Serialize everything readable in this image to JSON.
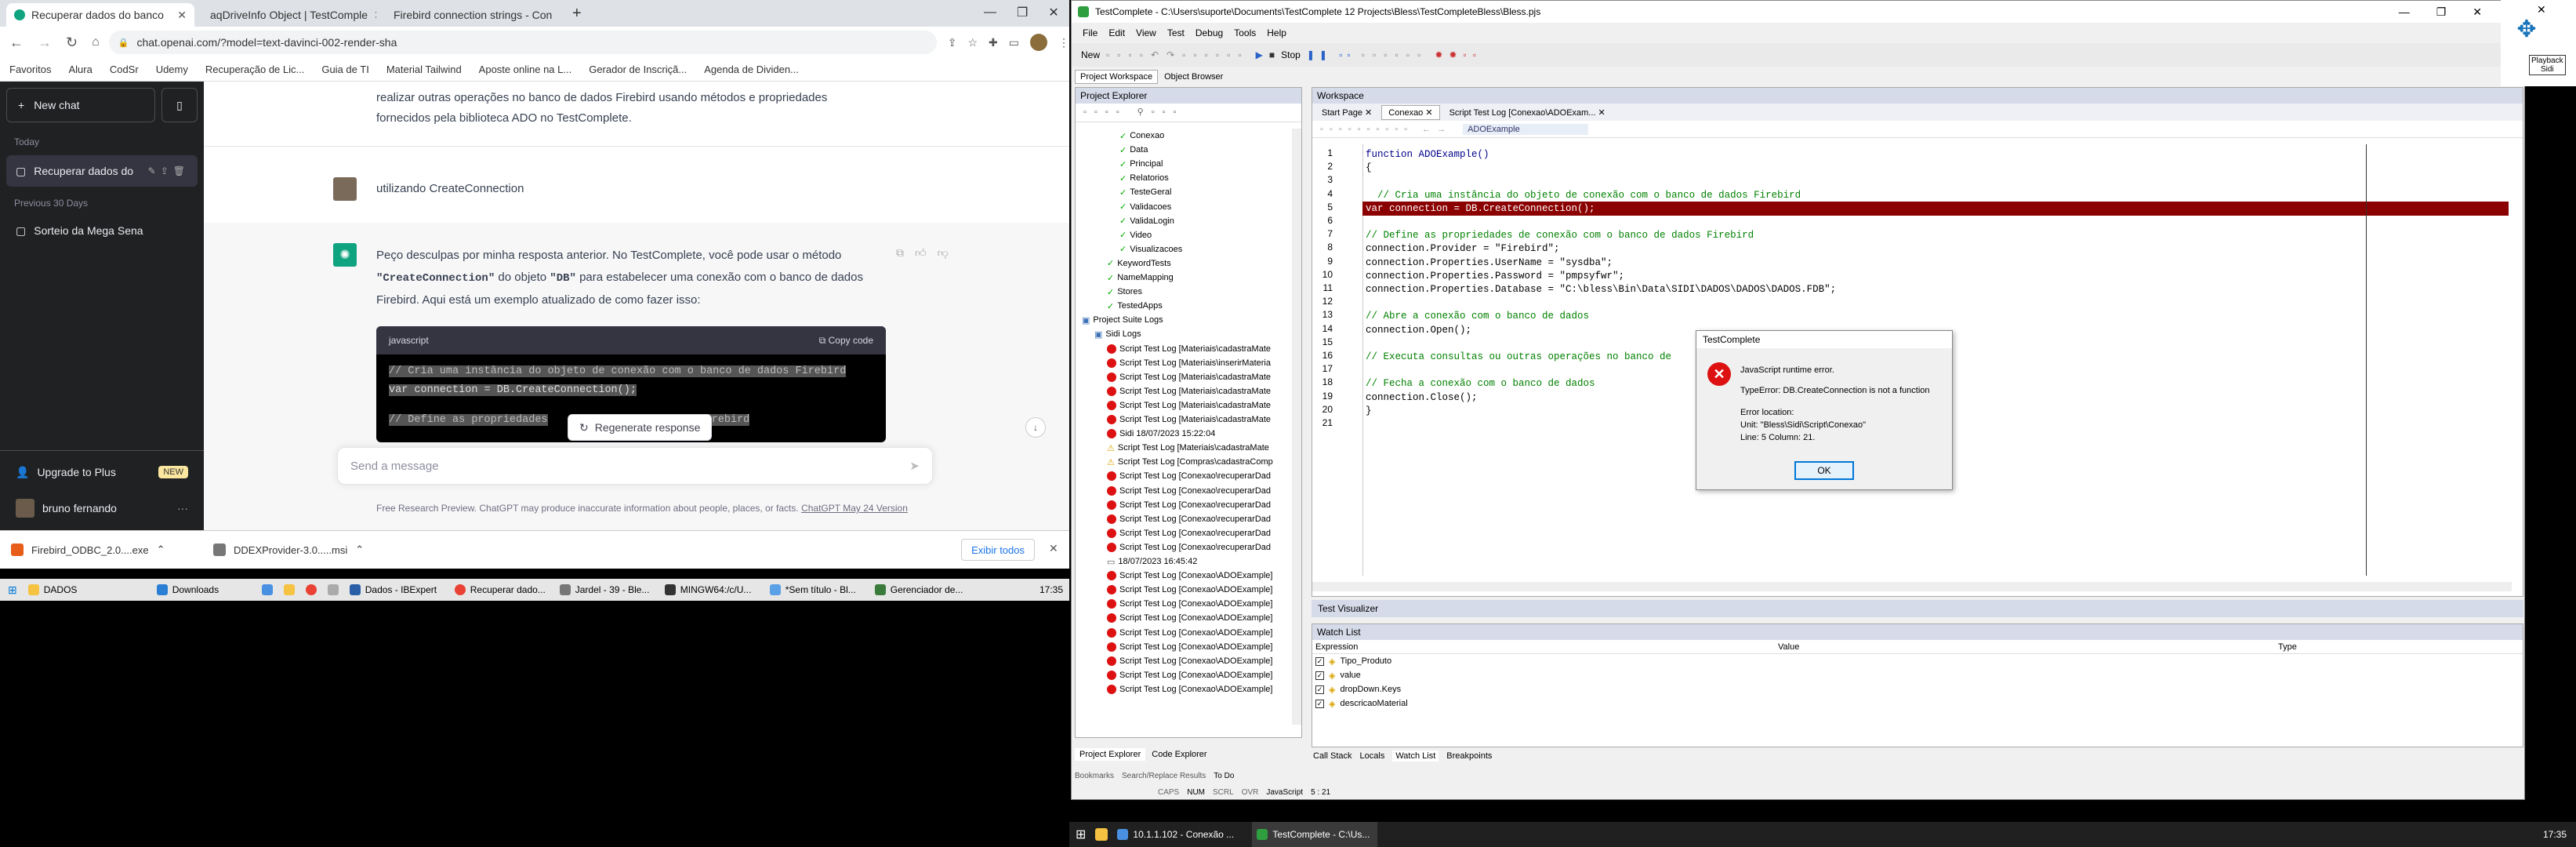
{
  "browser": {
    "tabs": [
      {
        "title": "Recuperar dados do banco",
        "active": true
      },
      {
        "title": "aqDriveInfo Object | TestComple",
        "active": false
      },
      {
        "title": "Firebird connection strings - Con",
        "active": false
      }
    ],
    "new_tab": "+",
    "url": "chat.openai.com/?model=text-davinci-002-render-sha",
    "bookmarks": [
      "Favoritos",
      "Alura",
      "CodSr",
      "Udemy",
      "Recuperação de Lic...",
      "Guia de TI",
      "Material Tailwind",
      "Aposte online na L...",
      "Gerador de Inscriçã...",
      "Agenda de Dividen..."
    ]
  },
  "sidebar": {
    "new_chat": "New chat",
    "today_label": "Today",
    "today_item": "Recuperar dados do",
    "prev_label": "Previous 30 Days",
    "prev_item": "Sorteio da Mega Sena",
    "upgrade": "Upgrade to Plus",
    "upgrade_badge": "NEW",
    "user": "bruno fernando"
  },
  "chat": {
    "top_text_1": "realizar outras operações no banco de dados Firebird usando métodos e propriedades",
    "top_text_2": "fornecidos pela biblioteca ADO no TestComplete.",
    "user_msg": "utilizando CreateConnection",
    "reply_1": "Peço desculpas por minha resposta anterior. No TestComplete, você pode usar o método",
    "reply_2a": "\"CreateConnection\"",
    "reply_2b": " do objeto ",
    "reply_2c": "\"DB\"",
    "reply_2d": " para estabelecer uma conexão com o banco de dados",
    "reply_3": "Firebird. Aqui está um exemplo atualizado de como fazer isso:",
    "code_lang": "javascript",
    "copy_code": "Copy code",
    "code_line_1": "// Cria uma instância do objeto de conexão com o banco de dados Firebird",
    "code_line_2": "var connection = DB.CreateConnection();",
    "code_line_3": "// Define as propriedades",
    "code_line_3b": "de dados Firebird",
    "regenerate": "Regenerate response",
    "placeholder": "Send a message",
    "disclaimer": "Free Research Preview. ChatGPT may produce inaccurate information about people, places, or facts.",
    "disclaimer_link": "ChatGPT May 24 Version"
  },
  "downloads": {
    "items": [
      "Firebird_ODBC_2.0....exe",
      "DDEXProvider-3.0.....msi"
    ],
    "show_all": "Exibir todos"
  },
  "taskbar1": {
    "items": [
      "DADOS",
      "Downloads",
      "Dados - IBExpert",
      "Recuperar dado...",
      "Jardel - 39 - Ble...",
      "MINGW64:/c/U...",
      "*Sem título - Bl...",
      "Gerenciador de..."
    ],
    "time": "17:35"
  },
  "taskbar2": {
    "items": [
      "10.1.1.102 - Conexão ...",
      "TestComplete - C:\\Us..."
    ],
    "time": "17:35"
  },
  "tc": {
    "title": "TestComplete - C:\\Users\\suporte\\Documents\\TestComplete 12 Projects\\Bless\\TestCompleteBless\\Bless.pjs",
    "menu": [
      "File",
      "Edit",
      "View",
      "Test",
      "Debug",
      "Tools",
      "Help"
    ],
    "toolbar_new": "New",
    "toolbar_stop": "Stop",
    "left_tabs": [
      "Project Workspace",
      "Object Browser"
    ],
    "explorer_title": "Project Explorer",
    "tree": [
      {
        "label": "Conexao",
        "indent": 3,
        "kind": "check"
      },
      {
        "label": "Data",
        "indent": 3,
        "kind": "check"
      },
      {
        "label": "Principal",
        "indent": 3,
        "kind": "check"
      },
      {
        "label": "Relatorios",
        "indent": 3,
        "kind": "check"
      },
      {
        "label": "TesteGeral",
        "indent": 3,
        "kind": "check"
      },
      {
        "label": "Validacoes",
        "indent": 3,
        "kind": "check"
      },
      {
        "label": "ValidaLogin",
        "indent": 3,
        "kind": "check"
      },
      {
        "label": "Video",
        "indent": 3,
        "kind": "check"
      },
      {
        "label": "Visualizacoes",
        "indent": 3,
        "kind": "check"
      },
      {
        "label": "KeywordTests",
        "indent": 2,
        "kind": "check"
      },
      {
        "label": "NameMapping",
        "indent": 2,
        "kind": "check"
      },
      {
        "label": "Stores",
        "indent": 2,
        "kind": "check"
      },
      {
        "label": "TestedApps",
        "indent": 2,
        "kind": "check"
      },
      {
        "label": "Project Suite Logs",
        "indent": 0,
        "kind": "folder"
      },
      {
        "label": "Sidi Logs",
        "indent": 1,
        "kind": "folder"
      },
      {
        "label": "Script Test Log [Materiais\\cadastraMate",
        "indent": 2,
        "kind": "err"
      },
      {
        "label": "Script Test Log [Materiais\\inserirMateria",
        "indent": 2,
        "kind": "err"
      },
      {
        "label": "Script Test Log [Materiais\\cadastraMate",
        "indent": 2,
        "kind": "err"
      },
      {
        "label": "Script Test Log [Materiais\\cadastraMate",
        "indent": 2,
        "kind": "err"
      },
      {
        "label": "Script Test Log [Materiais\\cadastraMate",
        "indent": 2,
        "kind": "err"
      },
      {
        "label": "Script Test Log [Materiais\\cadastraMate",
        "indent": 2,
        "kind": "err"
      },
      {
        "label": "Sidi 18/07/2023 15:22:04",
        "indent": 2,
        "kind": "err"
      },
      {
        "label": "Script Test Log [Materiais\\cadastraMate",
        "indent": 2,
        "kind": "warn"
      },
      {
        "label": "Script Test Log [Compras\\cadastraComp",
        "indent": 2,
        "kind": "warn"
      },
      {
        "label": "Script Test Log [Conexao\\recuperarDad",
        "indent": 2,
        "kind": "err"
      },
      {
        "label": "Script Test Log [Conexao\\recuperarDad",
        "indent": 2,
        "kind": "err"
      },
      {
        "label": "Script Test Log [Conexao\\recuperarDad",
        "indent": 2,
        "kind": "err"
      },
      {
        "label": "Script Test Log [Conexao\\recuperarDad",
        "indent": 2,
        "kind": "err"
      },
      {
        "label": "Script Test Log [Conexao\\recuperarDad",
        "indent": 2,
        "kind": "err"
      },
      {
        "label": "Script Test Log [Conexao\\recuperarDad",
        "indent": 2,
        "kind": "err"
      },
      {
        "label": "18/07/2023 16:45:42",
        "indent": 2,
        "kind": "doc"
      },
      {
        "label": "Script Test Log [Conexao\\ADOExample]",
        "indent": 2,
        "kind": "err"
      },
      {
        "label": "Script Test Log [Conexao\\ADOExample]",
        "indent": 2,
        "kind": "err"
      },
      {
        "label": "Script Test Log [Conexao\\ADOExample]",
        "indent": 2,
        "kind": "err"
      },
      {
        "label": "Script Test Log [Conexao\\ADOExample]",
        "indent": 2,
        "kind": "err"
      },
      {
        "label": "Script Test Log [Conexao\\ADOExample]",
        "indent": 2,
        "kind": "err"
      },
      {
        "label": "Script Test Log [Conexao\\ADOExample]",
        "indent": 2,
        "kind": "err"
      },
      {
        "label": "Script Test Log [Conexao\\ADOExample]",
        "indent": 2,
        "kind": "err"
      },
      {
        "label": "Script Test Log [Conexao\\ADOExample]",
        "indent": 2,
        "kind": "err"
      },
      {
        "label": "Script Test Log [Conexao\\ADOExample]",
        "indent": 2,
        "kind": "err"
      }
    ],
    "bottom_left_tabs": [
      "Project Explorer",
      "Code Explorer"
    ],
    "bottom_tabs2": [
      "Bookmarks",
      "Search/Replace Results",
      "To Do"
    ],
    "workspace_title": "Workspace",
    "doc_tabs": [
      "Start Page",
      "Conexao",
      "Script Test Log [Conexao\\ADOExam..."
    ],
    "routine": "ADOExample",
    "code": [
      {
        "n": "1",
        "t": "function ADOExample()",
        "c": "kw"
      },
      {
        "n": "2",
        "t": "{",
        "c": "plain"
      },
      {
        "n": "3",
        "t": "",
        "c": "plain"
      },
      {
        "n": "4",
        "t": "  // Cria uma instância do objeto de conexão com o banco de dados Firebird",
        "c": "cm"
      },
      {
        "n": "5",
        "t": "var connection = DB.CreateConnection();",
        "c": "hl"
      },
      {
        "n": "6",
        "t": "",
        "c": "plain"
      },
      {
        "n": "7",
        "t": "// Define as propriedades de conexão com o banco de dados Firebird",
        "c": "cm"
      },
      {
        "n": "8",
        "t": "connection.Provider = \"Firebird\";",
        "c": "str"
      },
      {
        "n": "9",
        "t": "connection.Properties.UserName = \"sysdba\";",
        "c": "str"
      },
      {
        "n": "10",
        "t": "connection.Properties.Password = \"pmpsyfwr\";",
        "c": "str"
      },
      {
        "n": "11",
        "t": "connection.Properties.Database = \"C:\\bless\\Bin\\Data\\SIDI\\DADOS\\DADOS\\DADOS.FDB\";",
        "c": "str"
      },
      {
        "n": "12",
        "t": "",
        "c": "plain"
      },
      {
        "n": "13",
        "t": "// Abre a conexão com o banco de dados",
        "c": "cm"
      },
      {
        "n": "14",
        "t": "connection.Open();",
        "c": "plain"
      },
      {
        "n": "15",
        "t": "",
        "c": "plain"
      },
      {
        "n": "16",
        "t": "// Executa consultas ou outras operações no banco de",
        "c": "cm"
      },
      {
        "n": "17",
        "t": "",
        "c": "plain"
      },
      {
        "n": "18",
        "t": "// Fecha a conexão com o banco de dados",
        "c": "cm"
      },
      {
        "n": "19",
        "t": "connection.Close();",
        "c": "plain"
      },
      {
        "n": "20",
        "t": "}",
        "c": "plain"
      },
      {
        "n": "21",
        "t": "",
        "c": "plain"
      }
    ],
    "dialog": {
      "title": "TestComplete",
      "message": "JavaScript runtime error.",
      "detail": "TypeError: DB.CreateConnection is not a function",
      "location_label": "Error location:",
      "unit": "Unit: \"Bless\\Sidi\\Script\\Conexao\"",
      "line": "Line: 5 Column: 21.",
      "ok": "OK"
    },
    "visualizer_title": "Test Visualizer",
    "watch_title": "Watch List",
    "watch_headers": [
      "Expression",
      "Value",
      "Type"
    ],
    "watch_items": [
      "Tipo_Produto",
      "value",
      "dropDown.Keys",
      "descricaoMaterial"
    ],
    "debug_tabs": [
      "Call Stack",
      "Locals",
      "Watch List",
      "Breakpoints"
    ],
    "status": [
      "CAPS",
      "NUM",
      "SCRL",
      "OVR",
      "JavaScript",
      "5 : 21"
    ]
  },
  "playback": {
    "label": "Playback",
    "sub": "Sidi"
  }
}
